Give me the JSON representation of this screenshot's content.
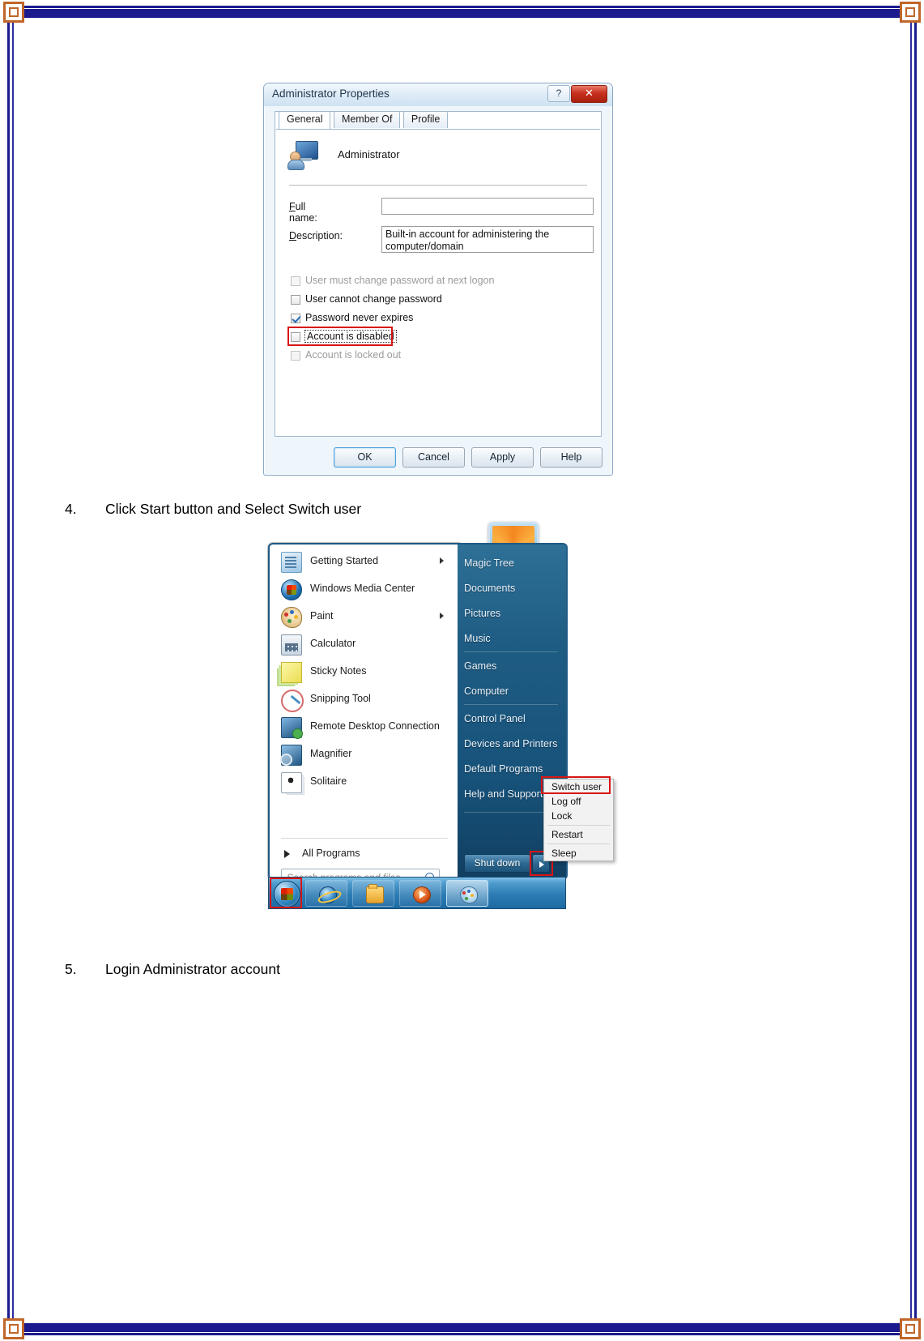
{
  "document": {
    "steps": [
      {
        "number": "4.",
        "text": "Click Start button and Select Switch user"
      },
      {
        "number": "5.",
        "text": "Login Administrator account"
      }
    ]
  },
  "properties_dialog": {
    "title": "Administrator Properties",
    "help_button": "?",
    "close_button": "✕",
    "tabs": [
      {
        "label": "General",
        "active": true
      },
      {
        "label": "Member Of",
        "active": false
      },
      {
        "label": "Profile",
        "active": false
      }
    ],
    "account_name": "Administrator",
    "fields": [
      {
        "label": "Full name:",
        "value": ""
      },
      {
        "label": "Description:",
        "value": "Built-in account for administering the computer/domain"
      }
    ],
    "checkboxes": [
      {
        "label": "User must change password at next logon",
        "checked": false,
        "disabled": true,
        "highlighted": false
      },
      {
        "label": "User cannot change password",
        "checked": false,
        "disabled": false,
        "highlighted": false
      },
      {
        "label": "Password never expires",
        "checked": true,
        "disabled": false,
        "highlighted": false
      },
      {
        "label": "Account is disabled",
        "checked": false,
        "disabled": false,
        "highlighted": true
      },
      {
        "label": "Account is locked out",
        "checked": false,
        "disabled": true,
        "highlighted": false
      }
    ],
    "buttons": [
      {
        "label": "OK",
        "default": true
      },
      {
        "label": "Cancel",
        "default": false
      },
      {
        "label": "Apply",
        "default": false
      },
      {
        "label": "Help",
        "default": false
      }
    ],
    "highlight_color": "#d81515"
  },
  "start_menu": {
    "programs": [
      {
        "label": "Getting Started",
        "icon": "getting-started-icon",
        "submenu": true
      },
      {
        "label": "Windows Media Center",
        "icon": "media-center-icon",
        "submenu": false
      },
      {
        "label": "Paint",
        "icon": "paint-icon",
        "submenu": true
      },
      {
        "label": "Calculator",
        "icon": "calculator-icon",
        "submenu": false
      },
      {
        "label": "Sticky Notes",
        "icon": "sticky-notes-icon",
        "submenu": false
      },
      {
        "label": "Snipping Tool",
        "icon": "snipping-tool-icon",
        "submenu": false
      },
      {
        "label": "Remote Desktop Connection",
        "icon": "remote-desktop-icon",
        "submenu": false
      },
      {
        "label": "Magnifier",
        "icon": "magnifier-icon",
        "submenu": false
      },
      {
        "label": "Solitaire",
        "icon": "solitaire-icon",
        "submenu": false
      }
    ],
    "all_programs": "All Programs",
    "search_placeholder": "Search programs and files",
    "right_links": [
      "Magic Tree",
      "Documents",
      "Pictures",
      "Music",
      "Games",
      "Computer",
      "Control Panel",
      "Devices and Printers",
      "Default Programs",
      "Help and Support"
    ],
    "shutdown_label": "Shut down",
    "shutdown_menu": [
      "Switch user",
      "Log off",
      "Lock",
      "Restart",
      "Sleep"
    ],
    "highlighted_menu_item": "Switch user",
    "taskbar": {
      "start_orb": "windows-start-orb",
      "buttons": [
        {
          "icon": "internet-explorer-icon",
          "active": false
        },
        {
          "icon": "windows-explorer-icon",
          "active": false
        },
        {
          "icon": "media-player-icon",
          "active": false
        },
        {
          "icon": "paint-icon",
          "active": true
        }
      ]
    },
    "highlight_color": "#d81515"
  }
}
